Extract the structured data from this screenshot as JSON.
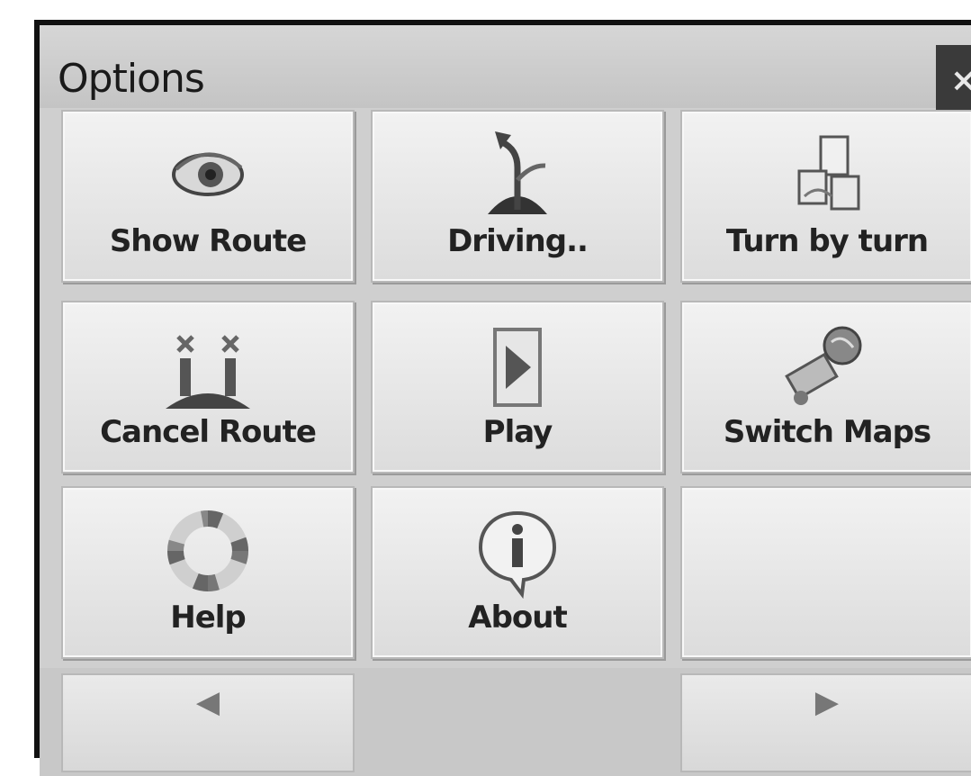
{
  "window": {
    "title": "Options",
    "close_glyph": "×"
  },
  "tiles": [
    {
      "label": "Show Route",
      "icon": "eye-icon"
    },
    {
      "label": "Driving..",
      "icon": "arrow-road-icon"
    },
    {
      "label": "Turn by turn",
      "icon": "turn-list-icon"
    },
    {
      "label": "Cancel Route",
      "icon": "cancel-route-icon"
    },
    {
      "label": "Play",
      "icon": "play-icon"
    },
    {
      "label": "Switch Maps",
      "icon": "globe-icon"
    },
    {
      "label": "Help",
      "icon": "lifebuoy-icon"
    },
    {
      "label": "About",
      "icon": "info-icon"
    },
    {
      "label": "",
      "icon": ""
    }
  ],
  "nav": {
    "prev_glyph": "◀",
    "next_glyph": "▶"
  },
  "colors": {
    "window_border": "#111111",
    "tile_bg": "#ececec",
    "titlebar_bg": "#cccccc"
  }
}
